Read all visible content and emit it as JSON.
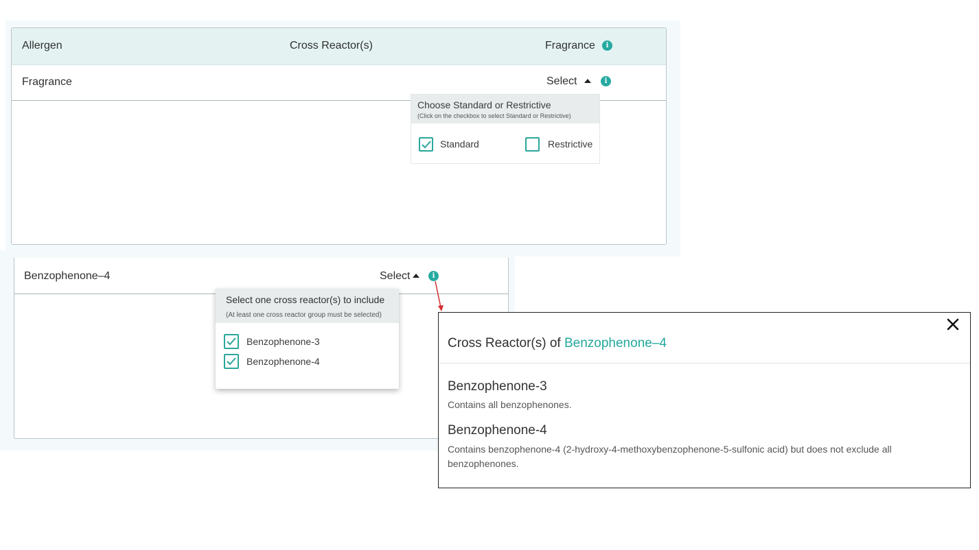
{
  "table": {
    "headers": {
      "allergen": "Allergen",
      "cross_reactors": "Cross Reactor(s)",
      "fragrance": "Fragrance"
    },
    "row": {
      "allergen": "Fragrance",
      "select_label": "Select"
    }
  },
  "fragrance_dropdown": {
    "title": "Choose Standard or Restrictive",
    "subtitle": "(Click on the checkbox to select Standard or Restrictive)",
    "options": [
      {
        "label": "Standard",
        "checked": true
      },
      {
        "label": "Restrictive",
        "checked": false
      }
    ]
  },
  "lower_row": {
    "allergen": "Benzophenone–4",
    "select_label": "Select"
  },
  "cross_reactor_dropdown": {
    "title": "Select one cross reactor(s) to include",
    "subtitle": "(At least one cross reactor group must be selected)",
    "options": [
      {
        "label": "Benzophenone-3",
        "checked": true
      },
      {
        "label": "Benzophenone-4",
        "checked": true
      }
    ]
  },
  "modal": {
    "title_prefix": "Cross Reactor(s) of ",
    "title_highlight": "Benzophenone–4",
    "items": [
      {
        "name": "Benzophenone-3",
        "description": "Contains all benzophenones."
      },
      {
        "name": "Benzophenone-4",
        "description": "Contains benzophenone-4 (2-hydroxy-4-methoxybenzophenone-5-sulfonic acid) but does not exclude all benzophenones."
      }
    ]
  },
  "colors": {
    "accent": "#26aaa0",
    "header_bg": "#e4f3f2",
    "arrow": "#d32f2f"
  },
  "icons": {
    "info": "info-icon",
    "check": "check-icon",
    "close": "close-icon",
    "caret": "caret-up-icon"
  }
}
